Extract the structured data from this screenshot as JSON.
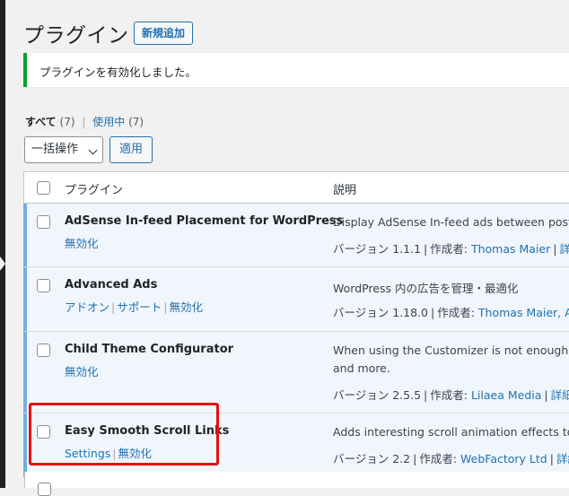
{
  "header": {
    "title": "プラグイン",
    "add_new_label": "新規追加"
  },
  "notice": {
    "text": "プラグインを有効化しました。"
  },
  "filters": {
    "all_label": "すべて",
    "all_count": "(7)",
    "separator": "|",
    "active_label": "使用中",
    "active_count": "(7)"
  },
  "bulk_actions": {
    "selected": "一括操作",
    "apply_label": "適用"
  },
  "table": {
    "columns": [
      "プラグイン",
      "説明"
    ],
    "rows": [
      {
        "name": "AdSense In-feed Placement for WordPress",
        "actions": [
          "無効化"
        ],
        "description": [
          "Display AdSense In-feed ads between posts"
        ],
        "version_label": "バージョン 1.1.1",
        "author_label": "作成者:",
        "author": "Thomas Maier",
        "details_label": "詳細"
      },
      {
        "name": "Advanced Ads",
        "actions": [
          "アドオン",
          "サポート",
          "無効化"
        ],
        "description": [
          "WordPress 内の広告を管理・最適化"
        ],
        "version_label": "バージョン 1.18.0",
        "author_label": "作成者:",
        "author": "Thomas Maier, Adv",
        "details_label": ""
      },
      {
        "name": "Child Theme Configurator",
        "actions": [
          "無効化"
        ],
        "description": [
          "When using the Customizer is not enough - Cr",
          "and more."
        ],
        "version_label": "バージョン 2.5.5",
        "author_label": "作成者:",
        "author": "Lilaea Media",
        "details_label": "詳細を"
      },
      {
        "name": "Easy Smooth Scroll Links",
        "actions": [
          "Settings",
          "無効化"
        ],
        "description": [
          "Adds interesting scroll animation effects to pa"
        ],
        "version_label": "バージョン 2.2",
        "author_label": "作成者:",
        "author": "WebFactory Ltd",
        "details_label": "詳細"
      }
    ]
  },
  "colors": {
    "accent": "#2271b1",
    "notice_success": "#00a32a",
    "active_row_bg": "#f0f6fc",
    "active_row_border": "#72aee6",
    "highlight": "#e51010"
  }
}
